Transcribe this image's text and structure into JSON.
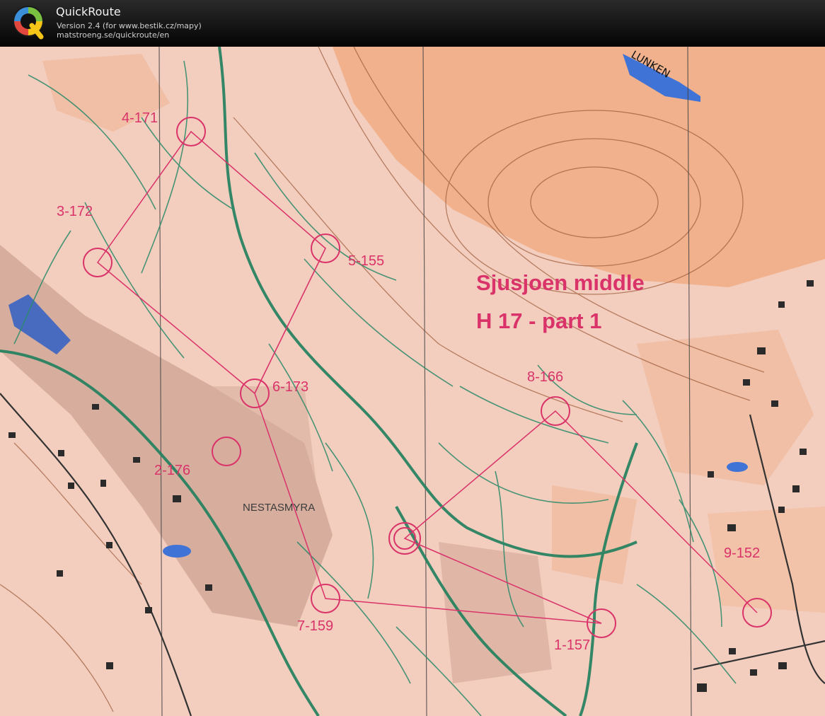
{
  "app": {
    "name": "QuickRoute",
    "version_line": "Version 2.4  (for www.bestik.cz/mapy)",
    "url_line": "matstroeng.se/quickroute/en",
    "logo_letter": "Q"
  },
  "map": {
    "title_line1": "Sjusjoen middle",
    "title_line2": "H 17 - part 1",
    "place_names": [
      "NESTASMYRA",
      "LUNKEN"
    ],
    "controls": [
      "1-157",
      "2-176",
      "3-172",
      "4-171",
      "5-155",
      "6-173",
      "7-159",
      "8-166",
      "9-152"
    ],
    "colors": {
      "course_magenta": "#d9336a",
      "path_green": "#1f7f5c",
      "terrain_orange": "#f0a77d",
      "water_blue": "#3f73d6"
    }
  }
}
